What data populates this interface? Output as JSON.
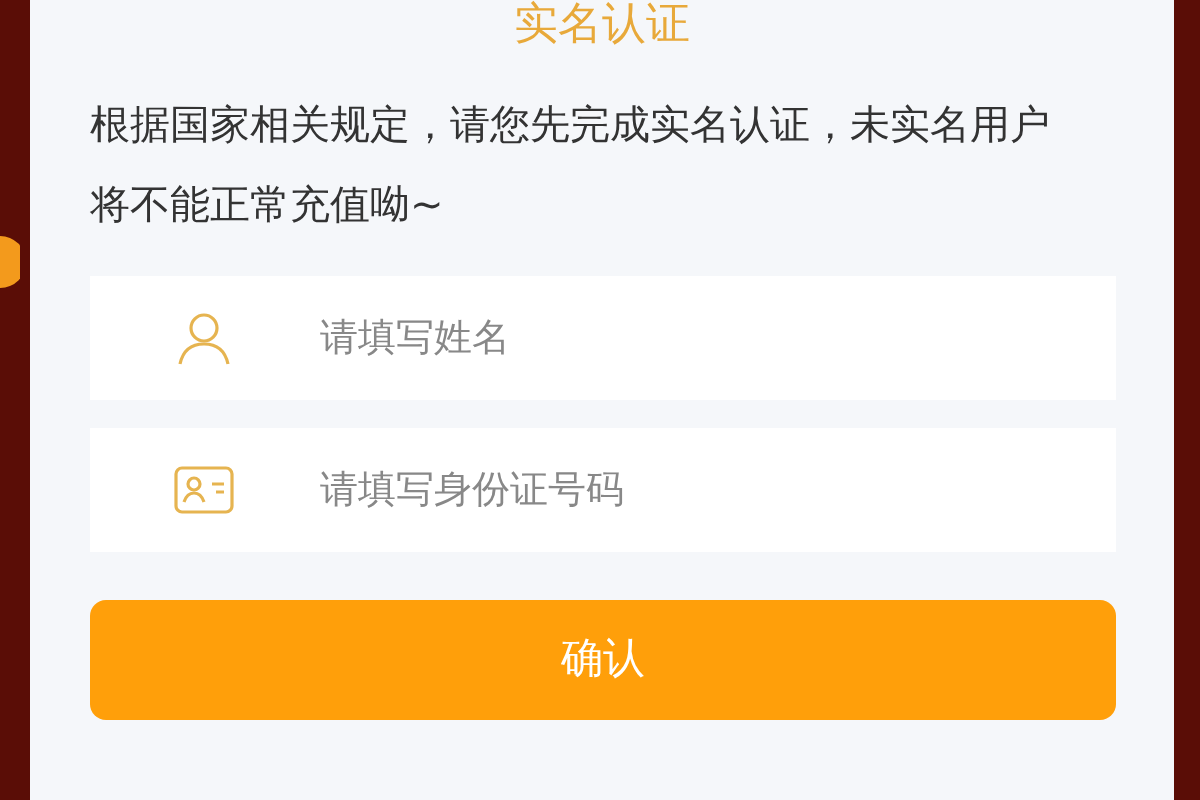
{
  "dialog": {
    "title": "实名认证",
    "notice": "根据国家相关规定，请您先完成实名认证，未实名用户将不能正常充值呦~",
    "fields": [
      {
        "kind": "name",
        "placeholder": "请填写姓名"
      },
      {
        "kind": "id",
        "placeholder": "请填写身份证号码"
      }
    ],
    "confirm_button": "确认"
  }
}
